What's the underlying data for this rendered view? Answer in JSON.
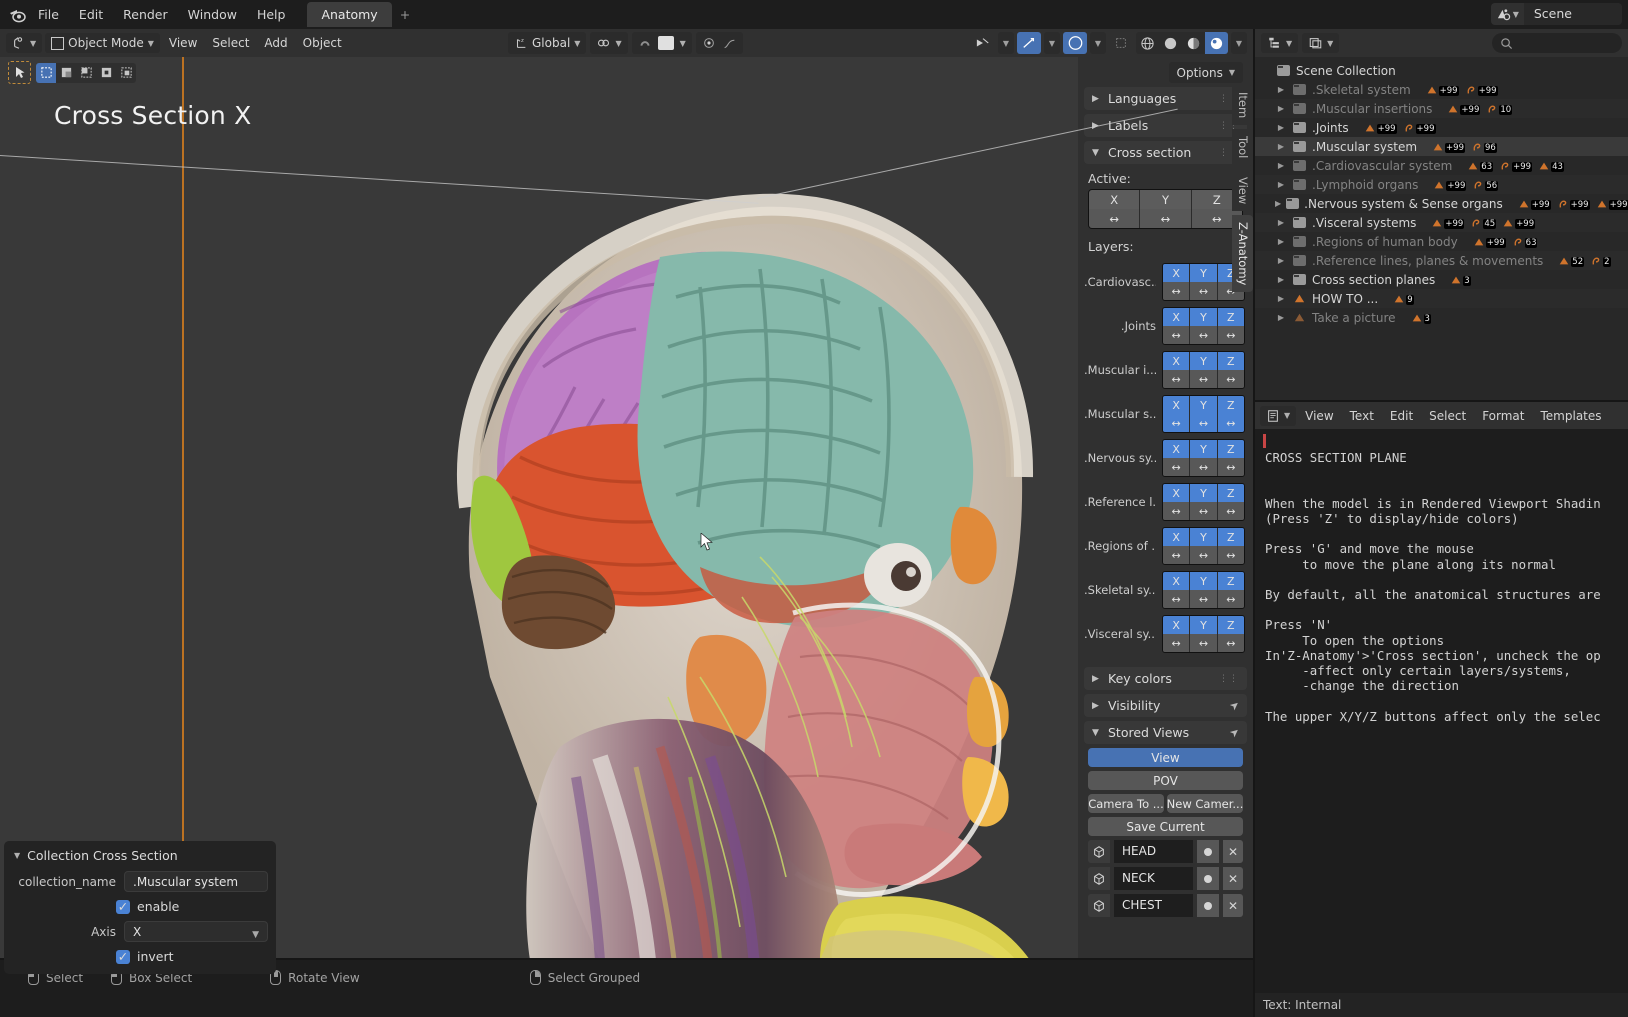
{
  "topbar": {
    "logo_icon": "blender-logo-icon",
    "menus": [
      "File",
      "Edit",
      "Render",
      "Window",
      "Help"
    ],
    "workspace_tab": "Anatomy",
    "add_workspace": "+",
    "scene_name": "Scene",
    "scene_icon": "scene-icon"
  },
  "viewport_header": {
    "editor_type_icon": "editor-type-3dview-icon",
    "mode": "Object Mode",
    "menus": [
      "View",
      "Select",
      "Add",
      "Object"
    ],
    "transform_orientation": "Global",
    "snap_icon": "snap-magnet-icon",
    "proportional_icon": "proportional-editing-icon",
    "falloff_icon": "falloff-smooth-icon",
    "pivot_icon": "pivot-point-icon",
    "gizmo_icon": "gizmo-icon",
    "overlays_icon": "overlays-icon",
    "xray_icon": "xray-toggle-icon",
    "shading_wireframe_icon": "shading-wireframe-icon",
    "shading_solid_icon": "shading-solid-icon",
    "shading_material_icon": "shading-material-preview-icon",
    "shading_rendered_icon": "shading-rendered-icon",
    "shading_dropdown_icon": "chevron-down-icon"
  },
  "viewport": {
    "label": "Cross Section X",
    "options_button": "Options",
    "options_chevron": "chevron-down-icon",
    "tool_cursor_icon": "select-box-tool-icon",
    "select_modes": [
      "set",
      "extend",
      "subtract",
      "invert",
      "intersect"
    ],
    "mouse_cursor_icon": "mouse-pointer-icon",
    "axis_color": "#d47d1e"
  },
  "npanel": {
    "tabs": [
      "Item",
      "Tool",
      "View",
      "Z-Anatomy"
    ],
    "active_tab": "Z-Anatomy",
    "panels": [
      {
        "title": "Languages",
        "open": false
      },
      {
        "title": "Labels",
        "open": false
      },
      {
        "title": "Cross section",
        "open": true
      }
    ],
    "active_label": "Active:",
    "active_axes": [
      "X",
      "Y",
      "Z"
    ],
    "arrow_glyph": "↔",
    "layers_label": "Layers:",
    "layers": [
      {
        "name": ".Cardiovasc...",
        "axes": [
          "X",
          "Y",
          "Z"
        ],
        "arrows_active": false
      },
      {
        "name": ".Joints",
        "axes": [
          "X",
          "Y",
          "Z"
        ],
        "arrows_active": false
      },
      {
        "name": ".Muscular i...",
        "axes": [
          "X",
          "Y",
          "Z"
        ],
        "arrows_active": false
      },
      {
        "name": ".Muscular s...",
        "axes": [
          "X",
          "Y",
          "Z"
        ],
        "arrows_active": true
      },
      {
        "name": ".Nervous sy...",
        "axes": [
          "X",
          "Y",
          "Z"
        ],
        "arrows_active": false
      },
      {
        "name": ".Reference l...",
        "axes": [
          "X",
          "Y",
          "Z"
        ],
        "arrows_active": false
      },
      {
        "name": ".Regions of ...",
        "axes": [
          "X",
          "Y",
          "Z"
        ],
        "arrows_active": false
      },
      {
        "name": ".Skeletal sy...",
        "axes": [
          "X",
          "Y",
          "Z"
        ],
        "arrows_active": false
      },
      {
        "name": ".Visceral sy...",
        "axes": [
          "X",
          "Y",
          "Z"
        ],
        "arrows_active": false
      }
    ],
    "lower_panels": [
      {
        "title": "Key colors",
        "open": false,
        "pin": false
      },
      {
        "title": "Visibility",
        "open": false,
        "pin": true
      },
      {
        "title": "Stored Views",
        "open": true,
        "pin": true
      }
    ],
    "stored_views": {
      "view_button": "View",
      "pov_button": "POV",
      "camera_to_button": "Camera To ...",
      "new_camera_button": "New Camer...",
      "save_current_button": "Save Current",
      "items": [
        {
          "name": "HEAD",
          "icon": "cube-icon"
        },
        {
          "name": "NECK",
          "icon": "cube-icon"
        },
        {
          "name": "CHEST",
          "icon": "cube-icon"
        }
      ]
    }
  },
  "operator_panel": {
    "title": "Collection Cross Section",
    "collapse_icon": "chevron-down-icon",
    "fields": [
      {
        "label": "collection_name",
        "value": ".Muscular system",
        "type": "text"
      },
      {
        "label": "enable",
        "value": "enable",
        "type": "checkbox",
        "checked": true
      },
      {
        "label": "Axis",
        "value": "X",
        "type": "select"
      },
      {
        "label": "invert",
        "value": "invert",
        "type": "checkbox",
        "checked": true
      }
    ]
  },
  "statusbar": {
    "items": [
      {
        "icon": "mouse-left-icon",
        "label": "Select"
      },
      {
        "icon": "mouse-left-drag-icon",
        "label": "Box Select"
      },
      {
        "icon": "mouse-middle-icon",
        "label": "Rotate View"
      },
      {
        "icon": "mouse-right-icon",
        "label": "Select Grouped"
      }
    ]
  },
  "outliner": {
    "display_mode_icon": "outliner-display-mode-icon",
    "filter_icon": "outliner-filter-icon",
    "search_icon": "search-icon",
    "root": "Scene Collection",
    "rows": [
      {
        "name": ".Skeletal system",
        "dim": true,
        "badges": [
          "+99",
          "+99"
        ]
      },
      {
        "name": ".Muscular insertions",
        "dim": true,
        "badges": [
          "+99",
          "10"
        ]
      },
      {
        "name": ".Joints",
        "dim": false,
        "badges": [
          "+99",
          "+99"
        ]
      },
      {
        "name": ".Muscular system",
        "dim": false,
        "badges": [
          "+99",
          "96"
        ],
        "selected": true
      },
      {
        "name": ".Cardiovascular system",
        "dim": true,
        "badges": [
          "63",
          "+99",
          "43"
        ]
      },
      {
        "name": ".Lymphoid organs",
        "dim": true,
        "badges": [
          "+99",
          "56"
        ]
      },
      {
        "name": ".Nervous system & Sense organs",
        "dim": false,
        "badges": [
          "+99",
          "+99",
          "+99"
        ]
      },
      {
        "name": ".Visceral systems",
        "dim": false,
        "badges": [
          "+99",
          "45",
          "+99"
        ]
      },
      {
        "name": ".Regions of human body",
        "dim": true,
        "badges": [
          "+99",
          "63"
        ]
      },
      {
        "name": ".Reference lines, planes & movements",
        "dim": true,
        "badges": [
          "52",
          "2"
        ]
      },
      {
        "name": "Cross section planes",
        "dim": false,
        "badges": [
          "3"
        ]
      },
      {
        "name": "HOW TO ...",
        "dim": false,
        "badges": [
          "9"
        ],
        "mesh": true
      },
      {
        "name": "Take a picture",
        "dim": true,
        "badges": [
          "3"
        ],
        "mesh": true
      }
    ]
  },
  "text_editor": {
    "editor_icon": "text-editor-icon",
    "menus": [
      "View",
      "Text",
      "Edit",
      "Select",
      "Format",
      "Templates"
    ],
    "content": "\nCROSS SECTION PLANE\n\n\nWhen the model is in Rendered Viewport Shadin\n(Press 'Z' to display/hide colors)\n\nPress 'G' and move the mouse\n     to move the plane along its normal\n\nBy default, all the anatomical structures are\n\nPress 'N'\n     To open the options\nIn'Z-Anatomy'>'Cross section', uncheck the op\n     -affect only certain layers/systems,\n     -change the direction\n\nThe upper X/Y/Z buttons affect only the selec",
    "footer": "Text: Internal"
  }
}
